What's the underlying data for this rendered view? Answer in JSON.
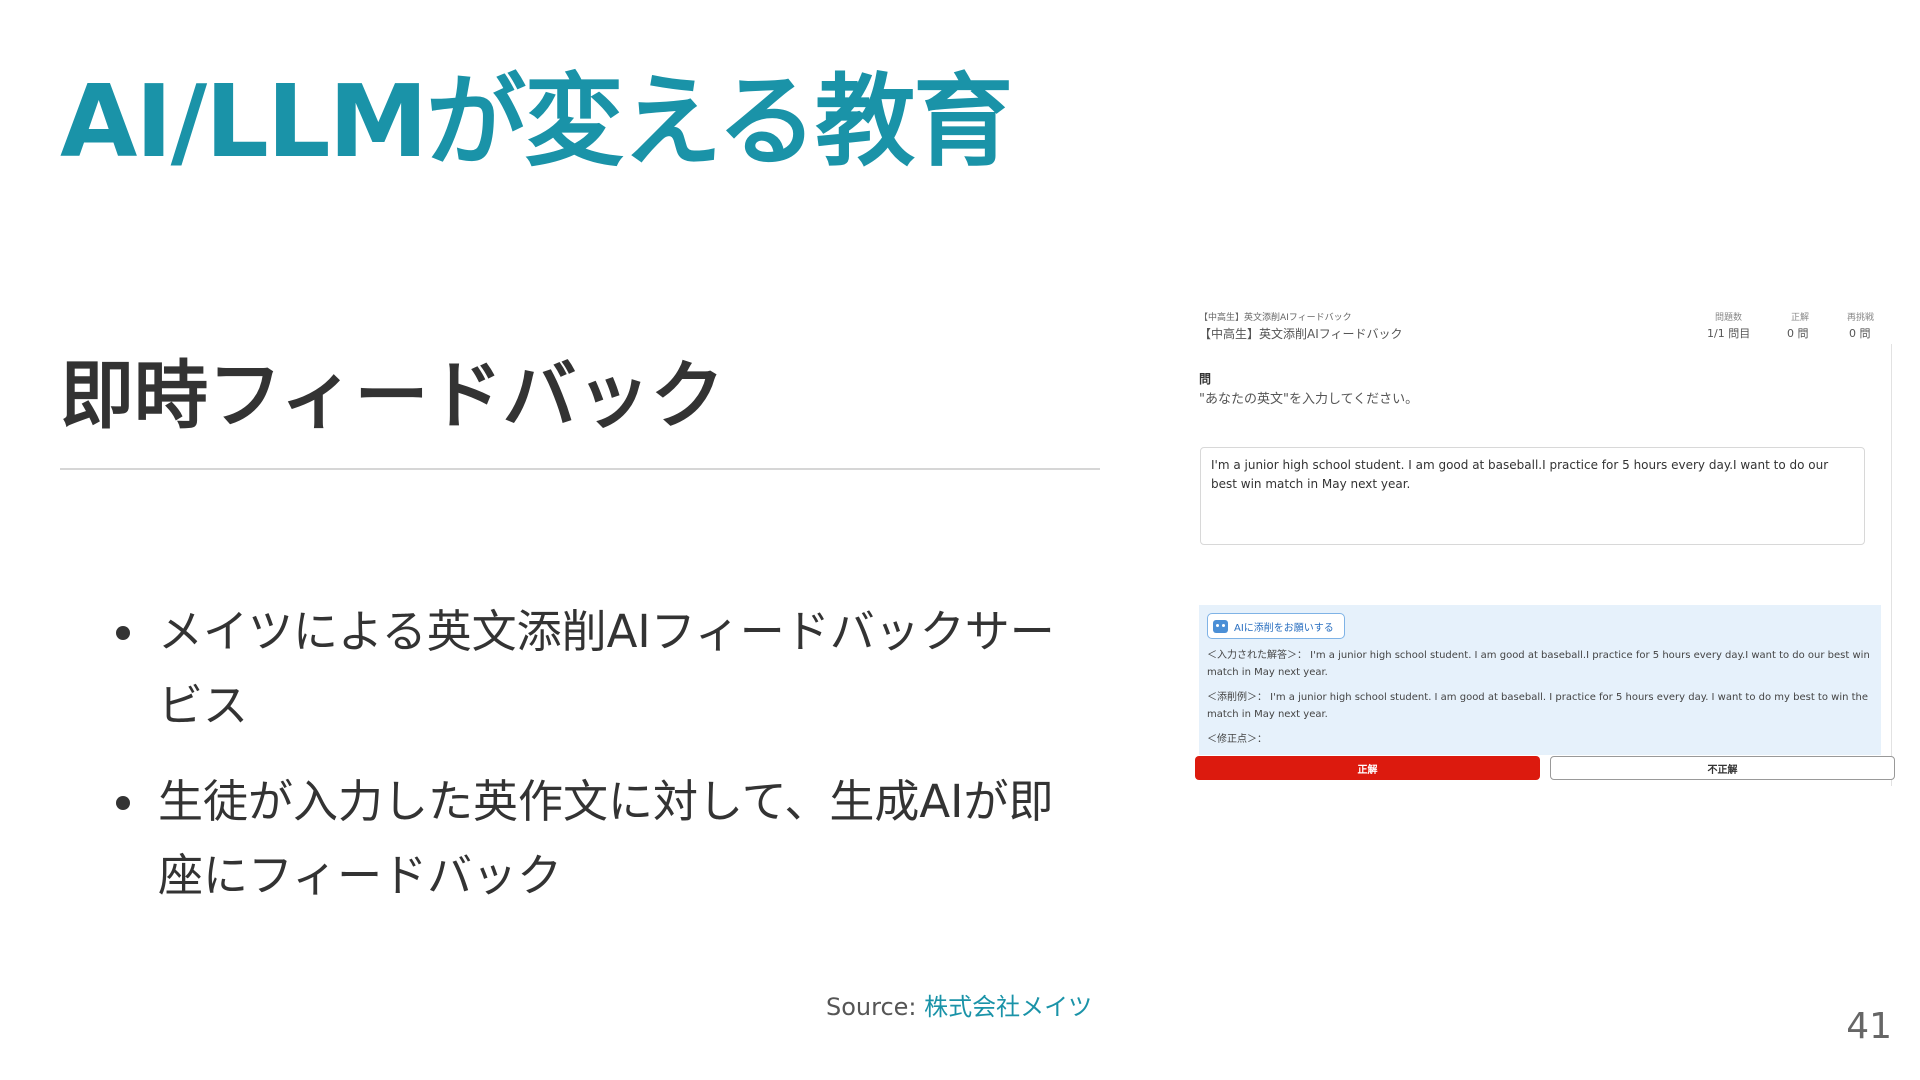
{
  "slide": {
    "title": "AI/LLMが変える教育",
    "subtitle": "即時フィードバック",
    "bullets": [
      "メイツによる英文添削AIフィードバックサービス",
      "生徒が入力した英作文に対して、生成AIが即座にフィードバック"
    ],
    "source_label": "Source:",
    "source_link": "株式会社メイツ",
    "page_number": "41",
    "accent_color": "#1a93a8"
  },
  "screenshot": {
    "header_small": "【中高生】英文添削AIフィードバック",
    "header_main": "【中高生】英文添削AIフィードバック",
    "stats": [
      {
        "label": "問題数",
        "value": "1/1 問目"
      },
      {
        "label": "正解",
        "value": "0 問"
      },
      {
        "label": "再挑戦",
        "value": "0 問"
      }
    ],
    "question_label": "問",
    "question_text": "\"あなたの英文\"を入力してください。",
    "answer_text": "I'm a junior high school student. I am good at baseball.I practice for 5 hours every day.I want to do our best win match in May next year.",
    "ai_button_label": "AIに添削をお願いする",
    "ai_button_icon": "robot-icon",
    "feedback_input_line": "＜入力された解答＞： I'm a junior high school student. I am good at baseball.I practice for 5 hours every day.I want to do our best win match in May next year.",
    "feedback_correction_line": "＜添削例＞： I'm a junior high school student. I am good at baseball. I practice for 5 hours every day. I want to do my best to win the match in May next year.",
    "feedback_points_line": "＜修正点＞：",
    "correct_button": "正解",
    "incorrect_button": "不正解",
    "correct_color": "#dc1a0e"
  }
}
